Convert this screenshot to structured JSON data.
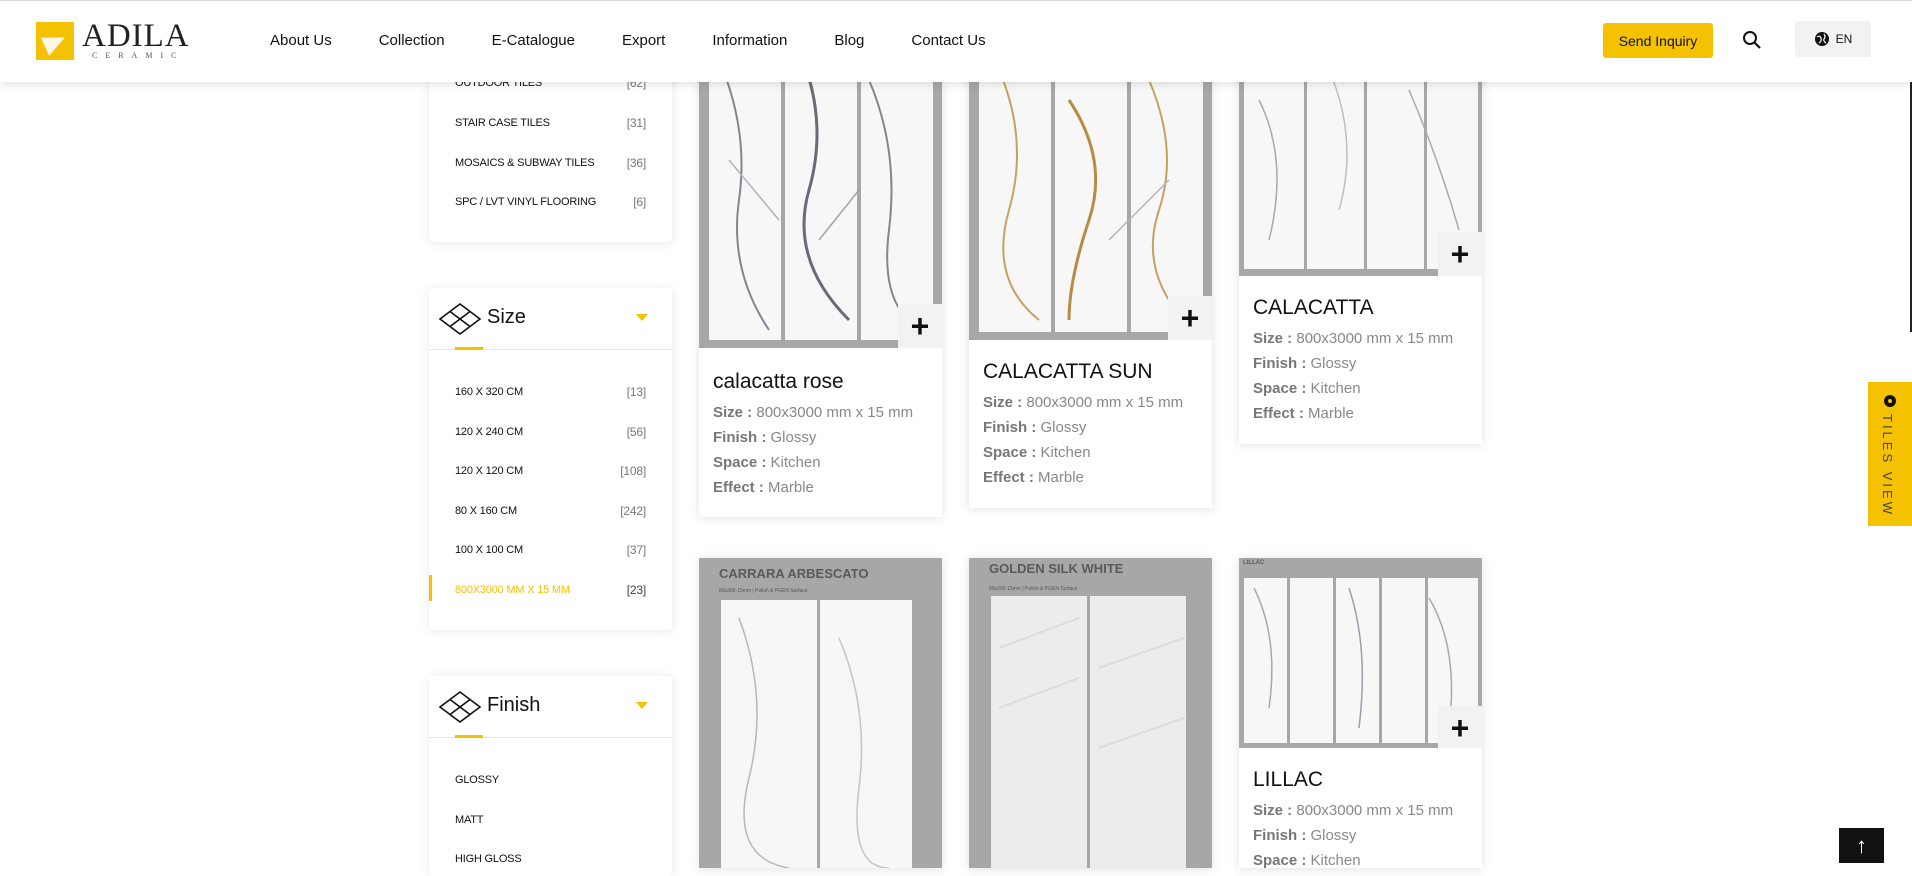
{
  "header": {
    "logo_main": "ADILA",
    "logo_sub": "CERAMIC",
    "nav": [
      "About Us",
      "Collection",
      "E-Catalogue",
      "Export",
      "Information",
      "Blog",
      "Contact Us"
    ],
    "send_inquiry": "Send Inquiry",
    "lang": "EN"
  },
  "category_panel": {
    "items": [
      {
        "label": "OUTDOOR TILES",
        "count": "[62]"
      },
      {
        "label": "STAIR CASE TILES",
        "count": "[31]"
      },
      {
        "label": "MOSAICS & SUBWAY TILES",
        "count": "[36]"
      },
      {
        "label": "SPC / LVT VINYL FLOORING",
        "count": "[6]"
      }
    ]
  },
  "size_panel": {
    "title": "Size",
    "items": [
      {
        "label": "160 X 320 CM",
        "count": "[13]"
      },
      {
        "label": "120 X 240 CM",
        "count": "[56]"
      },
      {
        "label": "120 X 120 CM",
        "count": "[108]"
      },
      {
        "label": "80 X 160 CM",
        "count": "[242]"
      },
      {
        "label": "100 X 100 CM",
        "count": "[37]"
      },
      {
        "label": "800X3000 MM X 15 MM",
        "count": "[23]",
        "active": true
      }
    ]
  },
  "finish_panel": {
    "title": "Finish",
    "items": [
      "GLOSSY",
      "MATT",
      "HIGH GLOSS"
    ]
  },
  "spec_labels": {
    "size": "Size :",
    "finish": "Finish :",
    "space": "Space :",
    "effect": "Effect :"
  },
  "products": [
    {
      "name": "calacatta rose",
      "size": "800x3000 mm x 15 mm",
      "finish": "Glossy",
      "space": "Kitchen",
      "effect": "Marble"
    },
    {
      "name": "CALACATTA SUN",
      "size": "800x3000 mm x 15 mm",
      "finish": "Glossy",
      "space": "Kitchen",
      "effect": "Marble"
    },
    {
      "name": "CALACATTA",
      "size": "800x3000 mm x 15 mm",
      "finish": "Glossy",
      "space": "Kitchen",
      "effect": "Marble"
    },
    {
      "name": "CARRARA ARBESCATO",
      "subtext": "80x300-15mm | Polish & PGEN Surface"
    },
    {
      "name": "GOLDEN SILK WHITE",
      "subtext": "80x300-15mm | Polish & PGEN Surface"
    },
    {
      "name": "LILLAC",
      "image_label": "LILLAC",
      "size": "800x3000 mm x 15 mm",
      "finish": "Glossy",
      "space": "Kitchen"
    }
  ],
  "tiles_view": "TILES VIEW",
  "plus": "+",
  "up_arrow": "↑",
  "colors": {
    "accent": "#f4c200",
    "gray_frame": "#a7a7a7"
  }
}
